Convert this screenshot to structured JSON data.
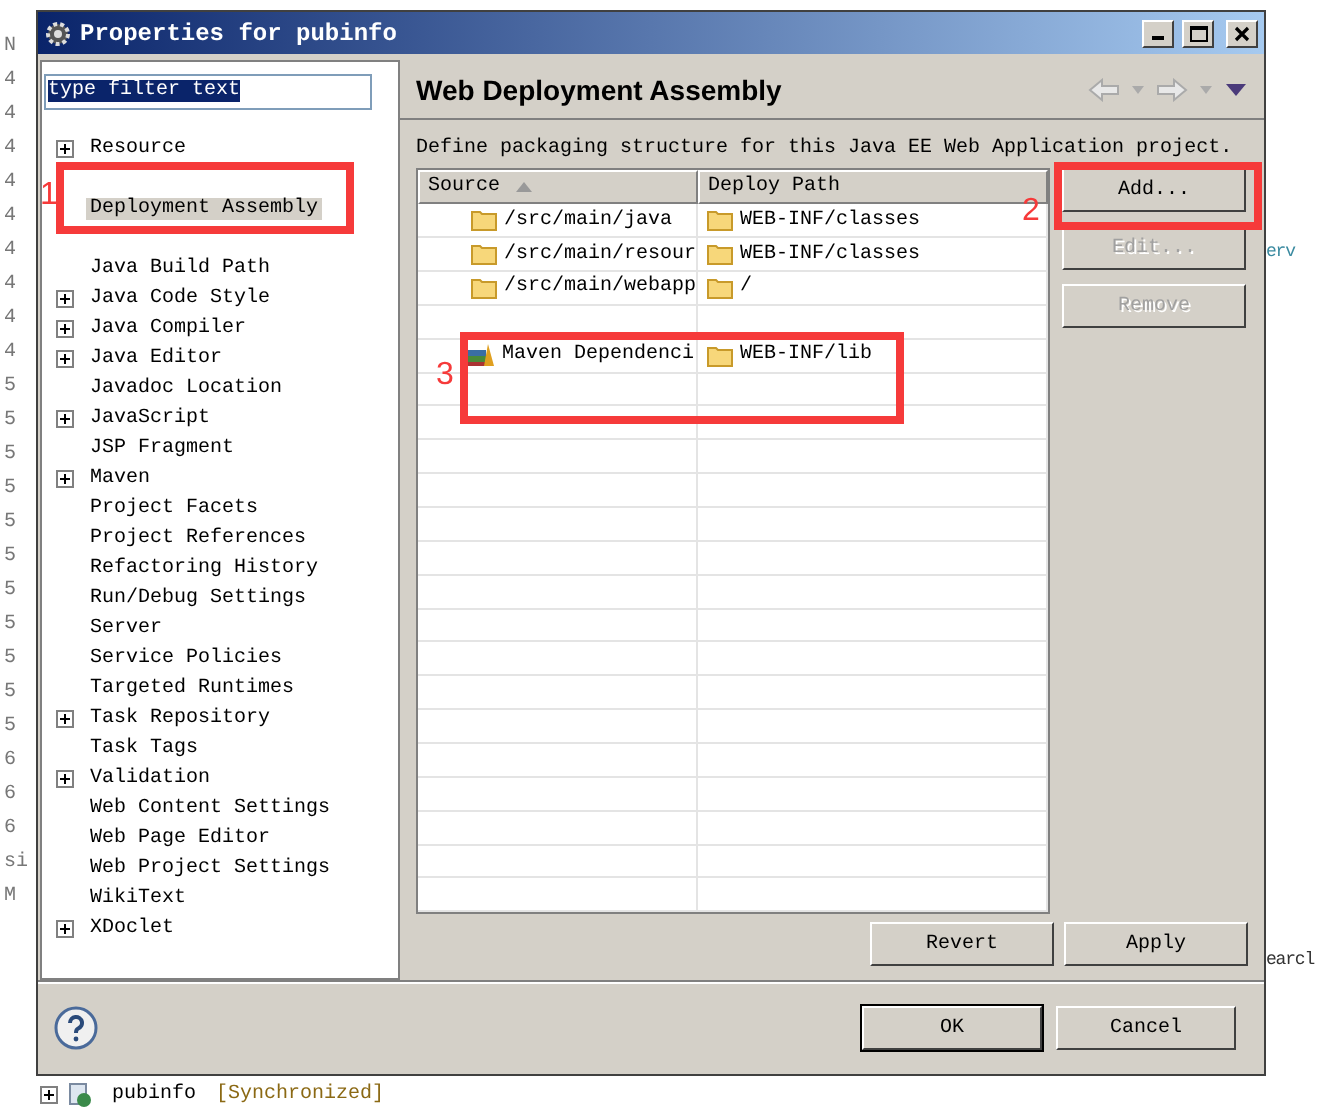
{
  "background": {
    "gutter": [
      "N",
      "4",
      "4",
      "4",
      "4",
      "4",
      "4",
      "4",
      "4",
      "4",
      "5",
      "5",
      "5",
      "5",
      "5",
      "5",
      "5",
      "5",
      "5",
      "5",
      "5",
      "6",
      "6",
      "6",
      "si",
      "M"
    ],
    "right_fragments": [
      "erv",
      "earcl"
    ],
    "project_row": {
      "name": "pubinfo",
      "status": "[Synchronized]",
      "expanded": false
    }
  },
  "window": {
    "title": "Properties for pubinfo"
  },
  "filter": {
    "value": "type filter text"
  },
  "tree": [
    {
      "label": "Resource",
      "kind": "group",
      "selected": false
    },
    {
      "kind": "covered"
    },
    {
      "label": "Deployment Assembly",
      "kind": "leaf",
      "selected": true
    },
    {
      "kind": "covered"
    },
    {
      "label": "Java Build Path",
      "kind": "leaf",
      "selected": false
    },
    {
      "label": "Java Code Style",
      "kind": "group",
      "selected": false
    },
    {
      "label": "Java Compiler",
      "kind": "group",
      "selected": false
    },
    {
      "label": "Java Editor",
      "kind": "group",
      "selected": false
    },
    {
      "label": "Javadoc Location",
      "kind": "leaf",
      "selected": false
    },
    {
      "label": "JavaScript",
      "kind": "group",
      "selected": false
    },
    {
      "label": "JSP Fragment",
      "kind": "leaf",
      "selected": false
    },
    {
      "label": "Maven",
      "kind": "group",
      "selected": false
    },
    {
      "label": "Project Facets",
      "kind": "leaf",
      "selected": false
    },
    {
      "label": "Project References",
      "kind": "leaf",
      "selected": false
    },
    {
      "label": "Refactoring History",
      "kind": "leaf",
      "selected": false
    },
    {
      "label": "Run/Debug Settings",
      "kind": "leaf",
      "selected": false
    },
    {
      "label": "Server",
      "kind": "leaf",
      "selected": false
    },
    {
      "label": "Service Policies",
      "kind": "leaf",
      "selected": false
    },
    {
      "label": "Targeted Runtimes",
      "kind": "leaf",
      "selected": false
    },
    {
      "label": "Task Repository",
      "kind": "group",
      "selected": false
    },
    {
      "label": "Task Tags",
      "kind": "leaf",
      "selected": false
    },
    {
      "label": "Validation",
      "kind": "group",
      "selected": false
    },
    {
      "label": "Web Content Settings",
      "kind": "leaf",
      "selected": false
    },
    {
      "label": "Web Page Editor",
      "kind": "leaf",
      "selected": false
    },
    {
      "label": "Web Project Settings",
      "kind": "leaf",
      "selected": false
    },
    {
      "label": "WikiText",
      "kind": "leaf",
      "selected": false
    },
    {
      "label": "XDoclet",
      "kind": "group",
      "selected": false
    }
  ],
  "page": {
    "title": "Web Deployment Assembly",
    "description": "Define packaging structure for this Java EE Web Application project."
  },
  "table": {
    "columns": [
      {
        "label": "Source",
        "sorted": true
      },
      {
        "label": "Deploy Path",
        "sorted": false
      }
    ],
    "rows": [
      {
        "kind": "folder",
        "source": "/src/main/java",
        "path": "WEB-INF/classes"
      },
      {
        "kind": "folder",
        "source": "/src/main/resour",
        "path": "WEB-INF/classes"
      },
      {
        "kind": "folder",
        "source": "/src/main/webapp",
        "path": "/"
      },
      {
        "kind": "covered"
      },
      {
        "kind": "library",
        "source": "Maven Dependenci",
        "path": "WEB-INF/lib"
      }
    ]
  },
  "side_buttons": [
    {
      "label": "Add...",
      "disabled": false
    },
    {
      "label": "Edit...",
      "disabled": true
    },
    {
      "label": "Remove",
      "disabled": true
    }
  ],
  "page_buttons": [
    {
      "label": "Revert"
    },
    {
      "label": "Apply"
    }
  ],
  "dialog_buttons": [
    {
      "label": "OK",
      "default": true
    },
    {
      "label": "Cancel",
      "default": false
    }
  ],
  "annotations": [
    {
      "number": "1"
    },
    {
      "number": "2"
    },
    {
      "number": "3"
    }
  ]
}
